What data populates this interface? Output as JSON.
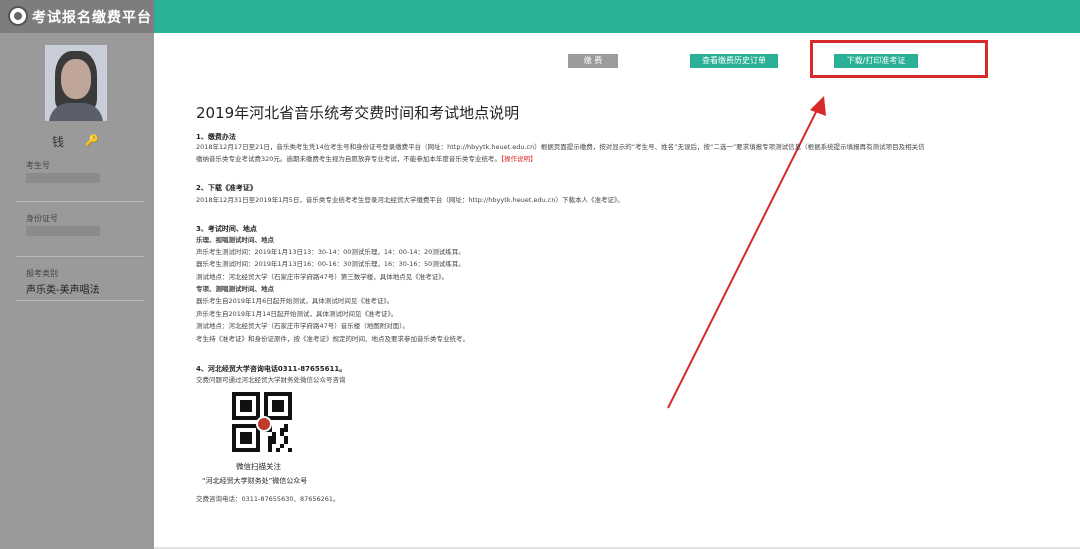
{
  "app": {
    "title": "考试报名缴费平台"
  },
  "sidebar": {
    "user_name": "钱",
    "student_no_label": "考生号",
    "id_label": "身份证号",
    "category_label": "报考类别",
    "category_value": "声乐类-美声唱法"
  },
  "toolbar": {
    "pay_label": "缴 费",
    "history_label": "查看缴费历史订单",
    "print_label": "下载/打印准考证"
  },
  "doc": {
    "title": "2019年河北省音乐统考交费时间和考试地点说明",
    "s1": {
      "heading": "1、缴费办法",
      "line1": "2018年12月17日至21日，音乐类考生凭14位考生号和身份证号登录缴费平台（网址：http://hbyytk.heuet.edu.cn）根据页面提示缴费，按对显示的“考生号、姓名”无误后，按“二选一”要求填报专项测试信息（根据系统提示填报再有测试项目及相关信",
      "line2": "缴纳音乐类专业考试费320元。逾期未缴费考生视为自愿放弃专业考试，不能参加本年度音乐类专业统考。",
      "link": "【操作说明】"
    },
    "s2": {
      "heading": "2、下载《准考证》",
      "line1": "2018年12月31日至2019年1月5日，音乐类专业统考考生登录河北经贸大学缴费平台（网址：http://hbyytk.heuet.edu.cn）下载本人《准考证》。"
    },
    "s3": {
      "heading": "3、考试时间、地点",
      "sub1": "乐理、视唱测试时间、地点",
      "lines": [
        "声乐考生测试时间：2019年1月13日13：30-14：00测试乐理，14：00-14：20测试练耳。",
        "器乐考生测试时间：2019年1月13日16：00-16：30测试乐理，16：30-16：50测试练耳。",
        "测试地点：河北经贸大学（石家庄市学府路47号）第三数学楼，具体地点见《准考证》。",
        "专项、测唱测试时间、地点",
        "器乐考生自2019年1月6日起开始测试，具体测试时间见《准考证》。",
        "声乐考生自2019年1月14日起开始测试，具体测试时间见《准考证》。",
        "测试地点：河北经贸大学（石家庄市学府路47号）音乐楼（地图附对面）。",
        "考生持《准考证》和身份证原件，按《准考证》规定的时间、地点及要求参加音乐类专业统考。"
      ]
    },
    "s4": {
      "heading": "4、河北经贸大学咨询电话0311-87655611。",
      "line1": "交费问题可通过河北经贸大学财务处微信公众号咨询"
    },
    "qr_caption": "微信扫描关注",
    "qr_account": "“河北经贸大学财务处”微信公众号",
    "phone": "交费咨询电话：0311-87655630、87656261。"
  }
}
